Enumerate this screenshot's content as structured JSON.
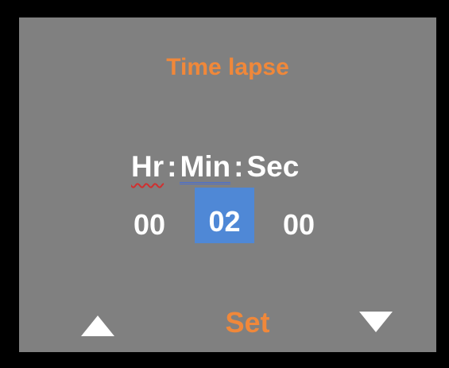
{
  "screen": {
    "title": "Time lapse",
    "accent_color": "#f0883a",
    "background_color": "#808080",
    "selection_color": "#4f88d6"
  },
  "header": {
    "hr_label": "Hr",
    "min_label": "Min",
    "sec_label": "Sec",
    "separator": ":"
  },
  "values": {
    "hours": "00",
    "minutes": "02",
    "seconds": "00",
    "selected_field": "minutes"
  },
  "controls": {
    "up_icon": "triangle-up-icon",
    "down_icon": "triangle-down-icon",
    "set_label": "Set"
  }
}
